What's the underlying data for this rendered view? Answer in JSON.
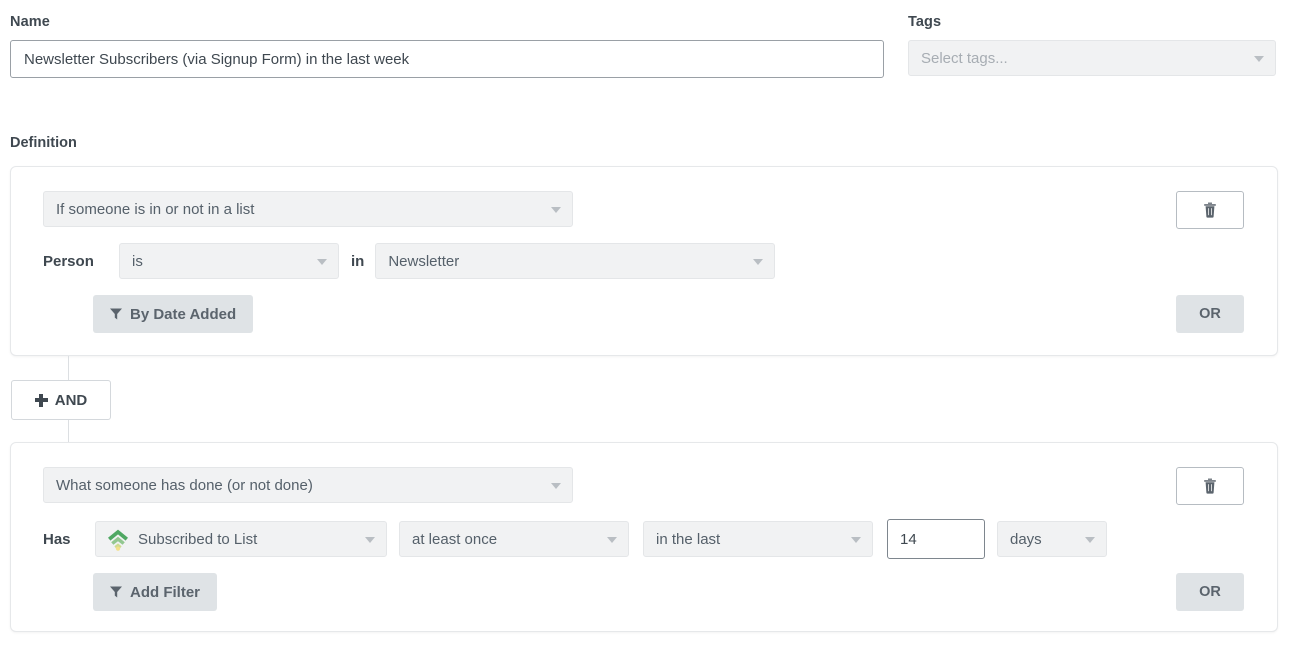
{
  "form": {
    "name_label": "Name",
    "name_value": "Newsletter Subscribers (via Signup Form) in the last week",
    "tags_label": "Tags",
    "tags_placeholder": "Select tags...",
    "definition_label": "Definition"
  },
  "blocks": [
    {
      "type_value": "If someone is in or not in a list",
      "row_label": "Person",
      "operator_value": "is",
      "connector_word": "in",
      "list_value": "Newsletter",
      "filter_button": "By Date Added",
      "delete_icon": "trash-icon",
      "or_label": "OR"
    },
    {
      "type_value": "What someone has done (or not done)",
      "row_label": "Has",
      "metric_icon": "signal-broadcast-icon",
      "metric_value": "Subscribed to List",
      "frequency_value": "at least once",
      "timeframe_value": "in the last",
      "amount_value": "14",
      "unit_value": "days",
      "filter_button": "Add Filter",
      "delete_icon": "trash-icon",
      "or_label": "OR"
    }
  ],
  "and_button": {
    "label": "AND",
    "icon": "plus-icon"
  },
  "colors": {
    "text": "#3f4850",
    "select_bg": "#f1f2f3",
    "button_bg": "#dfe3e6",
    "border": "#e6e8ea",
    "metric_icon_green": "#5cb85c",
    "metric_icon_yellow": "#f0d97a"
  }
}
